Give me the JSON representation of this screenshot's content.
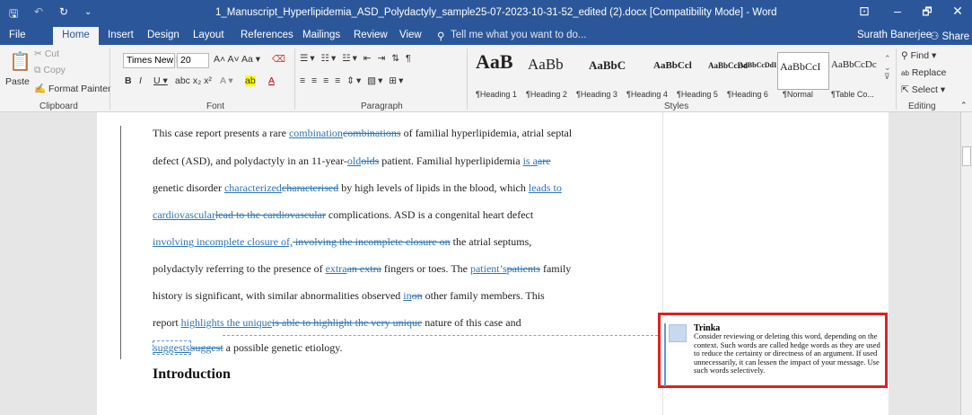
{
  "titlebar": {
    "title": "1_Manuscript_Hyperlipidemia_ASD_Polydactyly_sample25-07-2023-10-31-52_edited (2).docx [Compatibility Mode] - Word",
    "save": "🖫",
    "undo": "↶",
    "redo": "↻",
    "qat_more": "⌄",
    "display_opts": "⊡",
    "minimize": "–",
    "restore": "🗗",
    "close": "✕"
  },
  "menu": {
    "file": "File",
    "home": "Home",
    "insert": "Insert",
    "design": "Design",
    "layout": "Layout",
    "references": "References",
    "mailings": "Mailings",
    "review": "Review",
    "view": "View",
    "tell_me": "Tell me what you want to do...",
    "user": "Surath Banerjee",
    "share": "Share"
  },
  "clipboard": {
    "paste": "Paste",
    "cut": "Cut",
    "copy": "Copy",
    "format_painter": "Format Painter",
    "group": "Clipboard"
  },
  "font": {
    "name": "Times New Ro",
    "size": "20",
    "group": "Font"
  },
  "paragraph": {
    "group": "Paragraph"
  },
  "styles": {
    "group": "Styles",
    "items": [
      {
        "preview": "AaB",
        "label": "¶Heading 1"
      },
      {
        "preview": "AaBb",
        "label": "¶Heading 2"
      },
      {
        "preview": "AaBbC",
        "label": "¶Heading 3"
      },
      {
        "preview": "AaBbCcl",
        "label": "¶Heading 4"
      },
      {
        "preview": "AaBbCcDd",
        "label": "¶Heading 5"
      },
      {
        "preview": "AaBbCcDdI",
        "label": "¶Heading 6"
      },
      {
        "preview": "AaBbCcI",
        "label": "¶Normal"
      },
      {
        "preview": "AaBbCcDc",
        "label": "¶Table Co..."
      }
    ]
  },
  "editing": {
    "find": "Find",
    "replace": "Replace",
    "select": "Select",
    "group": "Editing"
  },
  "doc": {
    "l1": [
      "This case report presents a rare ",
      "combination",
      "combinations",
      " of familial hyperlipidemia, atrial septal"
    ],
    "l2": [
      "defect (ASD), and polydactyly in an 11-year-",
      "old",
      "olds",
      " patient. Familial hyperlipidemia ",
      "is a",
      "are"
    ],
    "l3": [
      "genetic disorder ",
      "characterized",
      "characterised",
      " by high levels of lipids in the blood, which ",
      "leads to"
    ],
    "l4": [
      "cardiovascular",
      "lead to the cardiovascular",
      " complications. ASD is a congenital heart defect"
    ],
    "l5": [
      "involving incomplete closure of,",
      " involving the incomplete closure on",
      " the atrial septums,"
    ],
    "l6": [
      "polydactyly referring to the presence of ",
      "extra",
      "an extra",
      " fingers or toes. The ",
      "patient’s",
      "patients",
      " family"
    ],
    "l7": [
      "history is significant, with similar abnormalities observed ",
      "in",
      "on",
      " other family members. This"
    ],
    "l8": [
      "report ",
      "highlights the unique",
      "is able to highlight the very unique",
      " nature of this case and"
    ],
    "l9": [
      "suggests",
      "suggest",
      " a possible genetic etiology."
    ],
    "heading": "Introduction"
  },
  "comment": {
    "author": "Trinka",
    "text": "Consider reviewing or deleting this word, depending on the context. Such words are called hedge words as they are used to reduce the certainty or directness of an argument. If used unnecessarily, it can lessen the impact of your message. Use such words selectively."
  }
}
